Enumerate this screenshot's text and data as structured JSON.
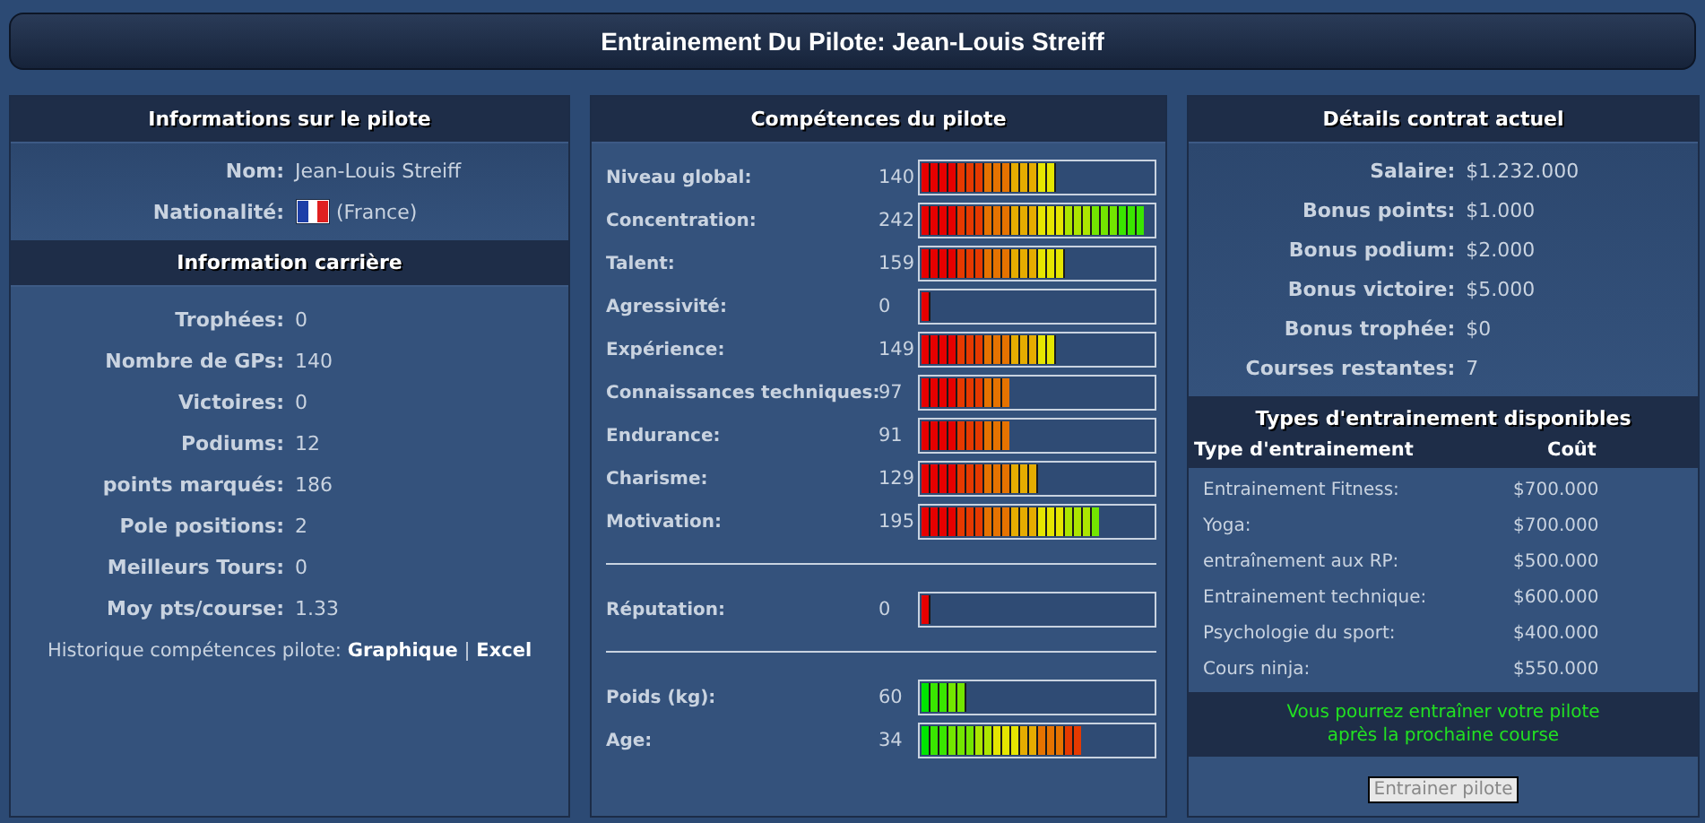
{
  "title": "Entrainement Du Pilote: Jean-Louis Streiff",
  "driver_info": {
    "title": "Informations sur le pilote",
    "name_label": "Nom:",
    "name": "Jean-Louis Streiff",
    "nationality_label": "Nationalité:",
    "nationality": "(France)"
  },
  "career": {
    "title": "Information carrière",
    "rows": [
      {
        "label": "Trophées:",
        "value": "0"
      },
      {
        "label": "Nombre de GPs:",
        "value": "140"
      },
      {
        "label": "Victoires:",
        "value": "0"
      },
      {
        "label": "Podiums:",
        "value": "12"
      },
      {
        "label": "points marqués:",
        "value": "186"
      },
      {
        "label": "Pole positions:",
        "value": "2"
      },
      {
        "label": "Meilleurs Tours:",
        "value": "0"
      },
      {
        "label": "Moy pts/course:",
        "value": "1.33"
      }
    ],
    "history_label": "Historique compétences pilote:",
    "links": [
      "Graphique",
      "Excel"
    ],
    "separator": "|"
  },
  "skills": {
    "title": "Compétences du pilote",
    "groups": [
      [
        {
          "label": "Niveau global:",
          "value": "140",
          "level": 0.58,
          "kind": "high_good"
        },
        {
          "label": "Concentration:",
          "value": "242",
          "level": 0.96,
          "kind": "high_good"
        },
        {
          "label": "Talent:",
          "value": "159",
          "level": 0.62,
          "kind": "high_good"
        },
        {
          "label": "Agressivité:",
          "value": "0",
          "level": 0.04,
          "kind": "high_good"
        },
        {
          "label": "Expérience:",
          "value": "149",
          "level": 0.58,
          "kind": "high_good"
        },
        {
          "label": "Connaissances techniques:",
          "value": "97",
          "level": 0.38,
          "kind": "high_good"
        },
        {
          "label": "Endurance:",
          "value": "91",
          "level": 0.38,
          "kind": "high_good"
        },
        {
          "label": "Charisme:",
          "value": "129",
          "level": 0.5,
          "kind": "high_good"
        },
        {
          "label": "Motivation:",
          "value": "195",
          "level": 0.77,
          "kind": "high_good"
        }
      ],
      [
        {
          "label": "Réputation:",
          "value": "0",
          "level": 0.04,
          "kind": "high_good"
        }
      ],
      [
        {
          "label": "Poids (kg):",
          "value": "60",
          "level": 0.19,
          "kind": "low_good"
        },
        {
          "label": "Age:",
          "value": "34",
          "level": 0.69,
          "kind": "low_good"
        }
      ]
    ]
  },
  "contract": {
    "title": "Détails contrat actuel",
    "rows": [
      {
        "label": "Salaire:",
        "value": "$1.232.000"
      },
      {
        "label": "Bonus points:",
        "value": "$1.000"
      },
      {
        "label": "Bonus podium:",
        "value": "$2.000"
      },
      {
        "label": "Bonus victoire:",
        "value": "$5.000"
      },
      {
        "label": "Bonus trophée:",
        "value": "$0"
      },
      {
        "label": "Courses restantes:",
        "value": "7"
      }
    ]
  },
  "training": {
    "title": "Types d'entrainement disponibles",
    "columns": [
      "Type d'entrainement",
      "Coût"
    ],
    "rows": [
      [
        "Entrainement Fitness:",
        "$700.000"
      ],
      [
        "Yoga:",
        "$700.000"
      ],
      [
        "entraînement aux RP:",
        "$500.000"
      ],
      [
        "Entrainement technique:",
        "$600.000"
      ],
      [
        "Psychologie du sport:",
        "$400.000"
      ],
      [
        "Cours ninja:",
        "$550.000"
      ]
    ],
    "notice": [
      "Vous pourrez entraîner votre pilote",
      "après la prochaine course"
    ],
    "button": {
      "label": "Entrainer pilote",
      "disabled": true
    }
  }
}
